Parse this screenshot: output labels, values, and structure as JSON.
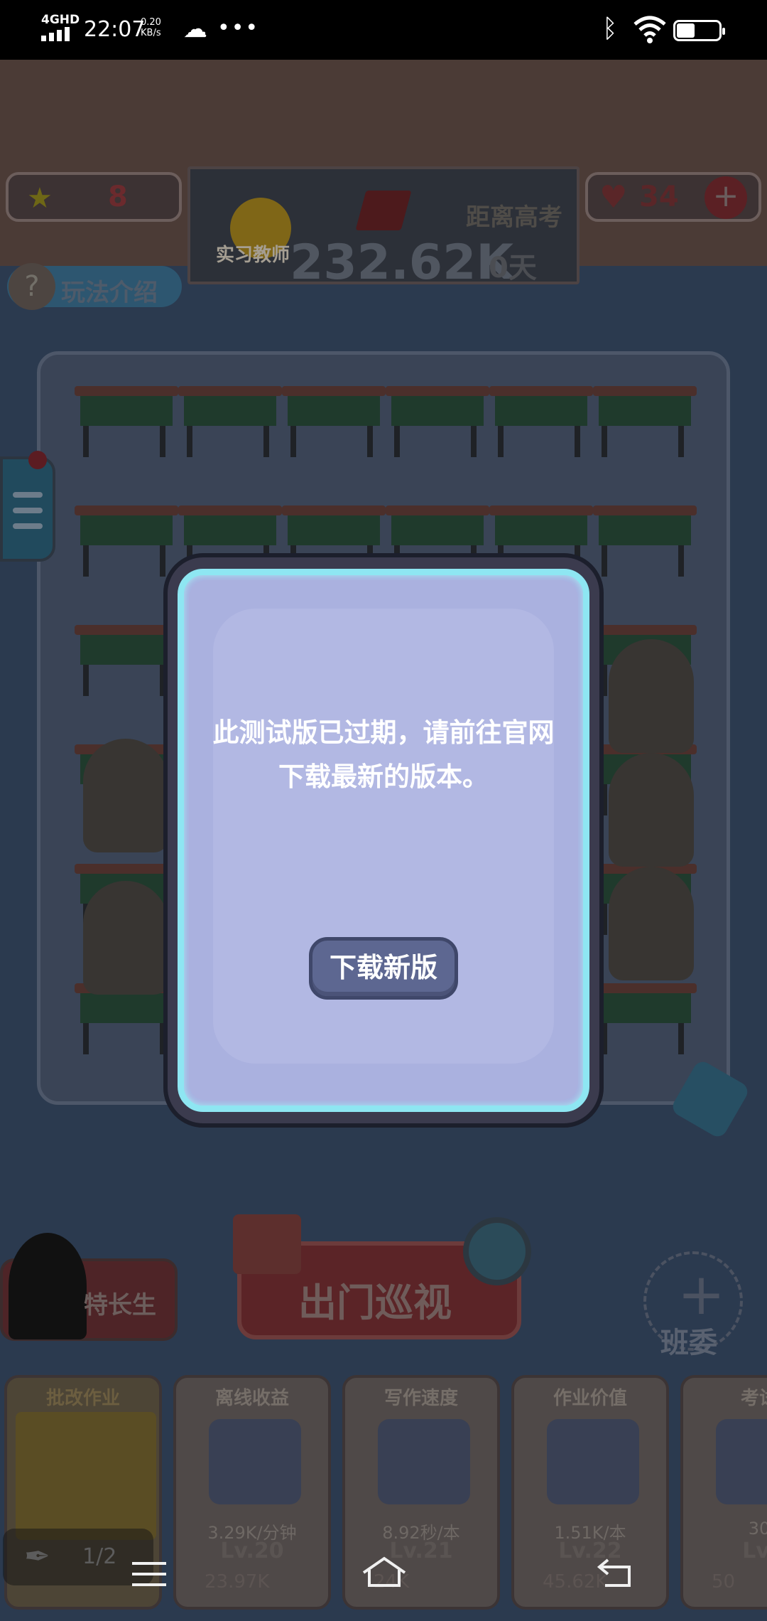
{
  "status_bar": {
    "network": "4GHD",
    "time": "22:07",
    "speed_value": "0.20",
    "speed_unit": "KB/s",
    "battery": "53"
  },
  "game": {
    "stars": "8",
    "rank_title": "实习教师",
    "money": "232.62K",
    "countdown_label": "距离高考",
    "countdown_days": "0天",
    "hearts": "34",
    "add_label": "+",
    "howto_label": "玩法介绍",
    "special_student_label": "特长生",
    "patrol_label": "出门巡视",
    "committee_label": "班委",
    "cards": [
      {
        "title": "批改作业",
        "rate": "",
        "level": "",
        "cost": ""
      },
      {
        "title": "离线收益",
        "rate": "3.29K/分钟",
        "level": "Lv.20",
        "cost": "23.97K"
      },
      {
        "title": "写作速度",
        "rate": "8.92秒/本",
        "level": "Lv.21",
        "cost": "24K"
      },
      {
        "title": "作业价值",
        "rate": "1.51K/本",
        "level": "Lv.22",
        "cost": "45.62K"
      },
      {
        "title": "考试",
        "rate": "30",
        "level": "Lv.",
        "cost": "50"
      }
    ],
    "pager": "1/2"
  },
  "dialog": {
    "message": "此测试版已过期，请前往官网下载最新的版本。",
    "button_label": "下载新版"
  },
  "nav": {
    "menu_icon": "menu-icon",
    "home_icon": "home-icon",
    "back_icon": "back-icon"
  }
}
